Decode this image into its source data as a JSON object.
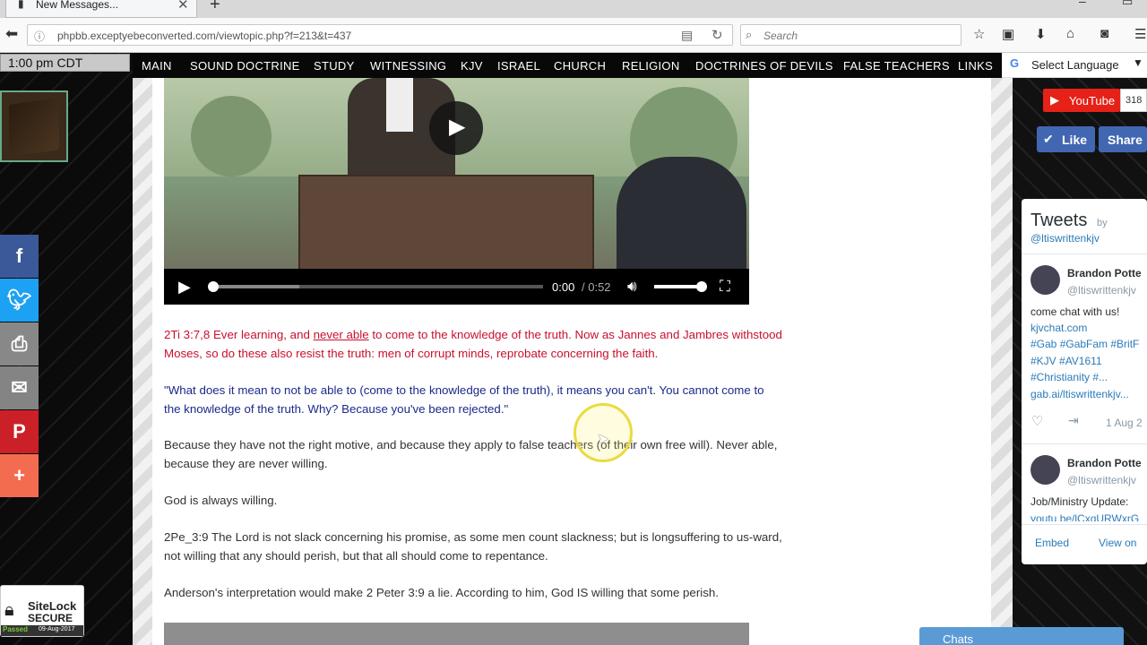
{
  "browser": {
    "tab_title": "New Messages...",
    "url": "phpbb.exceptyebeconverted.com/viewtopic.php?f=213&t=437",
    "search_placeholder": "Search"
  },
  "left": {
    "clock": "1:00 pm CDT",
    "share_buttons": [
      "facebook-icon",
      "twitter-icon",
      "print-icon",
      "email-icon",
      "pinterest-icon",
      "more-icon"
    ],
    "sitelock": {
      "brand": "SiteLock",
      "status": "SECURE",
      "passed": "Passed",
      "date": "09-Aug-2017"
    }
  },
  "menu": {
    "items": [
      "MAIN",
      "SOUND DOCTRINE",
      "STUDY",
      "WITNESSING",
      "KJV",
      "ISRAEL",
      "CHURCH",
      "RELIGION",
      "DOCTRINES OF DEVILS",
      "FALSE TEACHERS",
      "LINKS"
    ],
    "translate": "Select Language"
  },
  "video": {
    "current": "0:00",
    "duration": "/ 0:52",
    "progress": 0.0,
    "volume": 0.85
  },
  "content": {
    "p1_pre": "2Ti 3:7,8 Ever learning, and ",
    "p1_link": "never able",
    "p1_post": " to come to the knowledge of the truth. Now as Jannes and Jambres withstood Moses, so do these also resist the truth: men of corrupt minds, reprobate concerning the faith.",
    "p2": "\"What does it mean to not be able to (come to the knowledge of the truth), it means you can't. You cannot come to the knowledge of the truth. Why? Because you've been rejected.\"",
    "p3": "Because they have not the right motive, and because they apply to false teachers (of their own free will). Never able, because they are never willing.",
    "p4": "God is always willing.",
    "p5": "2Pe_3:9 The Lord is not slack concerning his promise, as some men count slackness; but is longsuffering to us-ward, not willing that any should perish, but that all should come to repentance.",
    "p6": "Anderson's interpretation would make 2 Peter 3:9 a lie. According to him, God IS willing that some perish."
  },
  "right": {
    "youtube": "YouTube",
    "youtube_count": "318",
    "like": "Like",
    "share": "Share",
    "tweets_title": "Tweets",
    "tweets_by": "by",
    "handle": "@ltiswrittenkjv",
    "tweet1": {
      "name": "Brandon Potte",
      "handle": "@ltiswrittenkjv",
      "text": "come chat with us!",
      "link1": "kjvchat.com",
      "tags1": "#Gab #GabFam #BritF",
      "tags2": "#KJV #AV1611",
      "tags3": "#Christianity #...",
      "link2": "gab.ai/ltiswrittenkjv...",
      "date": "1 Aug 2"
    },
    "tweet2": {
      "name": "Brandon Potte",
      "handle": "@ltiswrittenkjv",
      "text": "Job/Ministry Update:",
      "link": "youtu.be/lCxqURWxrG"
    },
    "embed": "Embed",
    "view_on": "View on"
  },
  "chats": "Chats"
}
